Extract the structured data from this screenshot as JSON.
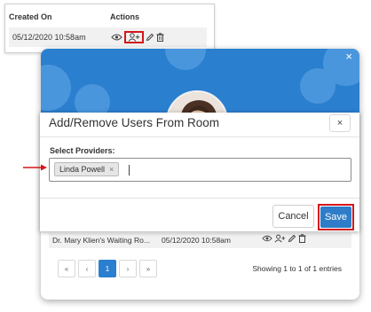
{
  "top_table": {
    "headers": {
      "created_on": "Created On",
      "actions": "Actions"
    },
    "row": {
      "created_on": "05/12/2020 10:58am"
    },
    "icons": [
      "eye-icon",
      "add-user-icon",
      "pencil-icon",
      "trash-icon"
    ]
  },
  "card": {
    "close_label": "×",
    "row": {
      "room": "Dr. Mary Klien's Waiting Ro...",
      "created_on": "05/12/2020 10:58am"
    },
    "pagination": [
      "«",
      "‹",
      "1",
      "›",
      "»"
    ],
    "active_page": "1",
    "entries": "Showing 1 to 1 of 1 entries"
  },
  "dialog": {
    "title": "Add/Remove Users From Room",
    "close_label": "×",
    "providers_label": "Select Providers:",
    "selected": [
      {
        "name": "Linda Powell",
        "remove": "×"
      }
    ],
    "cancel_label": "Cancel",
    "save_label": "Save"
  },
  "colors": {
    "primary": "#2f7dc8",
    "header_blue": "#2b7fcf",
    "highlight": "#d4161c"
  }
}
